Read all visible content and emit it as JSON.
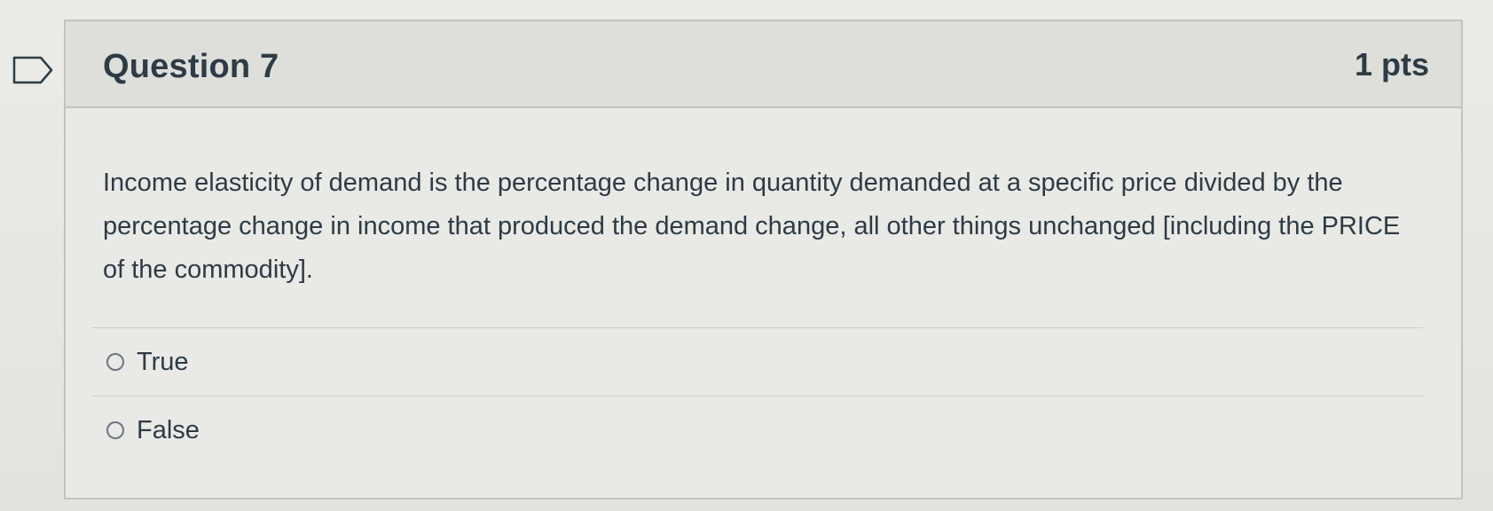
{
  "question": {
    "title": "Question 7",
    "points": "1 pts",
    "text": "Income elasticity of demand is the percentage change in quantity demanded at a specific price divided by the percentage change in income that produced the demand change, all other things unchanged [including the PRICE of the commodity].",
    "answers": [
      {
        "label": "True",
        "selected": false
      },
      {
        "label": "False",
        "selected": false
      }
    ]
  },
  "icons": {
    "flag": "flag-question-icon"
  },
  "colors": {
    "text": "#2d3b45",
    "header_bg": "#dededb",
    "border": "#c3c3bf"
  }
}
